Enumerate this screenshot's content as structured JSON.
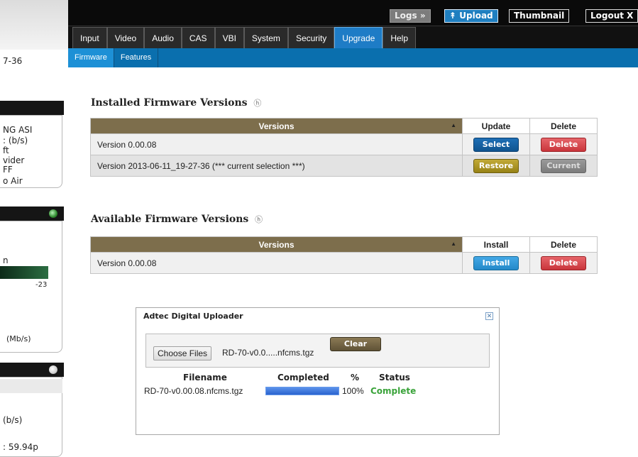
{
  "sidebar_fragments": {
    "text1": "7-36",
    "text2": "NG ASI",
    "text3": ": (b/s)",
    "text4": "ft",
    "text5": "vider",
    "text6": "FF",
    "text7": "o Air",
    "text8": "n",
    "text9": "-23",
    "text10": "(Mb/s)",
    "text11": "(b/s)",
    "text12": ": 59.94p"
  },
  "topbar": {
    "logs_label": "Logs",
    "logs_icon": "double-chevron-right",
    "upload_label": "Upload",
    "upload_icon": "double-chevron-up",
    "thumbnail_label": "Thumbnail",
    "logout_label": "Logout X"
  },
  "main_nav": {
    "tabs": [
      {
        "label": "Input"
      },
      {
        "label": "Video"
      },
      {
        "label": "Audio"
      },
      {
        "label": "CAS"
      },
      {
        "label": "VBI"
      },
      {
        "label": "System"
      },
      {
        "label": "Security"
      },
      {
        "label": "Upgrade",
        "active": true
      },
      {
        "label": "Help"
      }
    ]
  },
  "sub_nav": {
    "tabs": [
      {
        "label": "Firmware",
        "active": true
      },
      {
        "label": "Features"
      }
    ]
  },
  "installed": {
    "title": "Installed Firmware Versions",
    "help_icon": "circled-question-icon",
    "headers": {
      "versions": "Versions",
      "update": "Update",
      "delete": "Delete"
    },
    "rows": [
      {
        "version": "Version 0.00.08",
        "action_label": "Select",
        "delete_label": "Delete"
      },
      {
        "version": "Version 2013-06-11_19-27-36 (*** current selection ***)",
        "action_label": "Restore",
        "delete_label": "Current"
      }
    ]
  },
  "available": {
    "title": "Available Firmware Versions",
    "headers": {
      "versions": "Versions",
      "install": "Install",
      "delete": "Delete"
    },
    "rows": [
      {
        "version": "Version 0.00.08",
        "action_label": "Install",
        "delete_label": "Delete"
      }
    ]
  },
  "uploader": {
    "title": "Adtec Digital Uploader",
    "choose_files_label": "Choose Files",
    "chosen_file": "RD-70-v0.0.....nfcms.tgz",
    "clear_label": "Clear",
    "headers": {
      "filename": "Filename",
      "completed": "Completed",
      "percent": "%",
      "status": "Status"
    },
    "file": {
      "name": "RD-70-v0.00.08.nfcms.tgz",
      "progress_fraction": 1.0,
      "percent_text": "100%",
      "status": "Complete"
    }
  },
  "colors": {
    "accent_blue": "#1e7cc6",
    "table_header": "#7d6e4c",
    "status_complete": "#3aa33a"
  }
}
